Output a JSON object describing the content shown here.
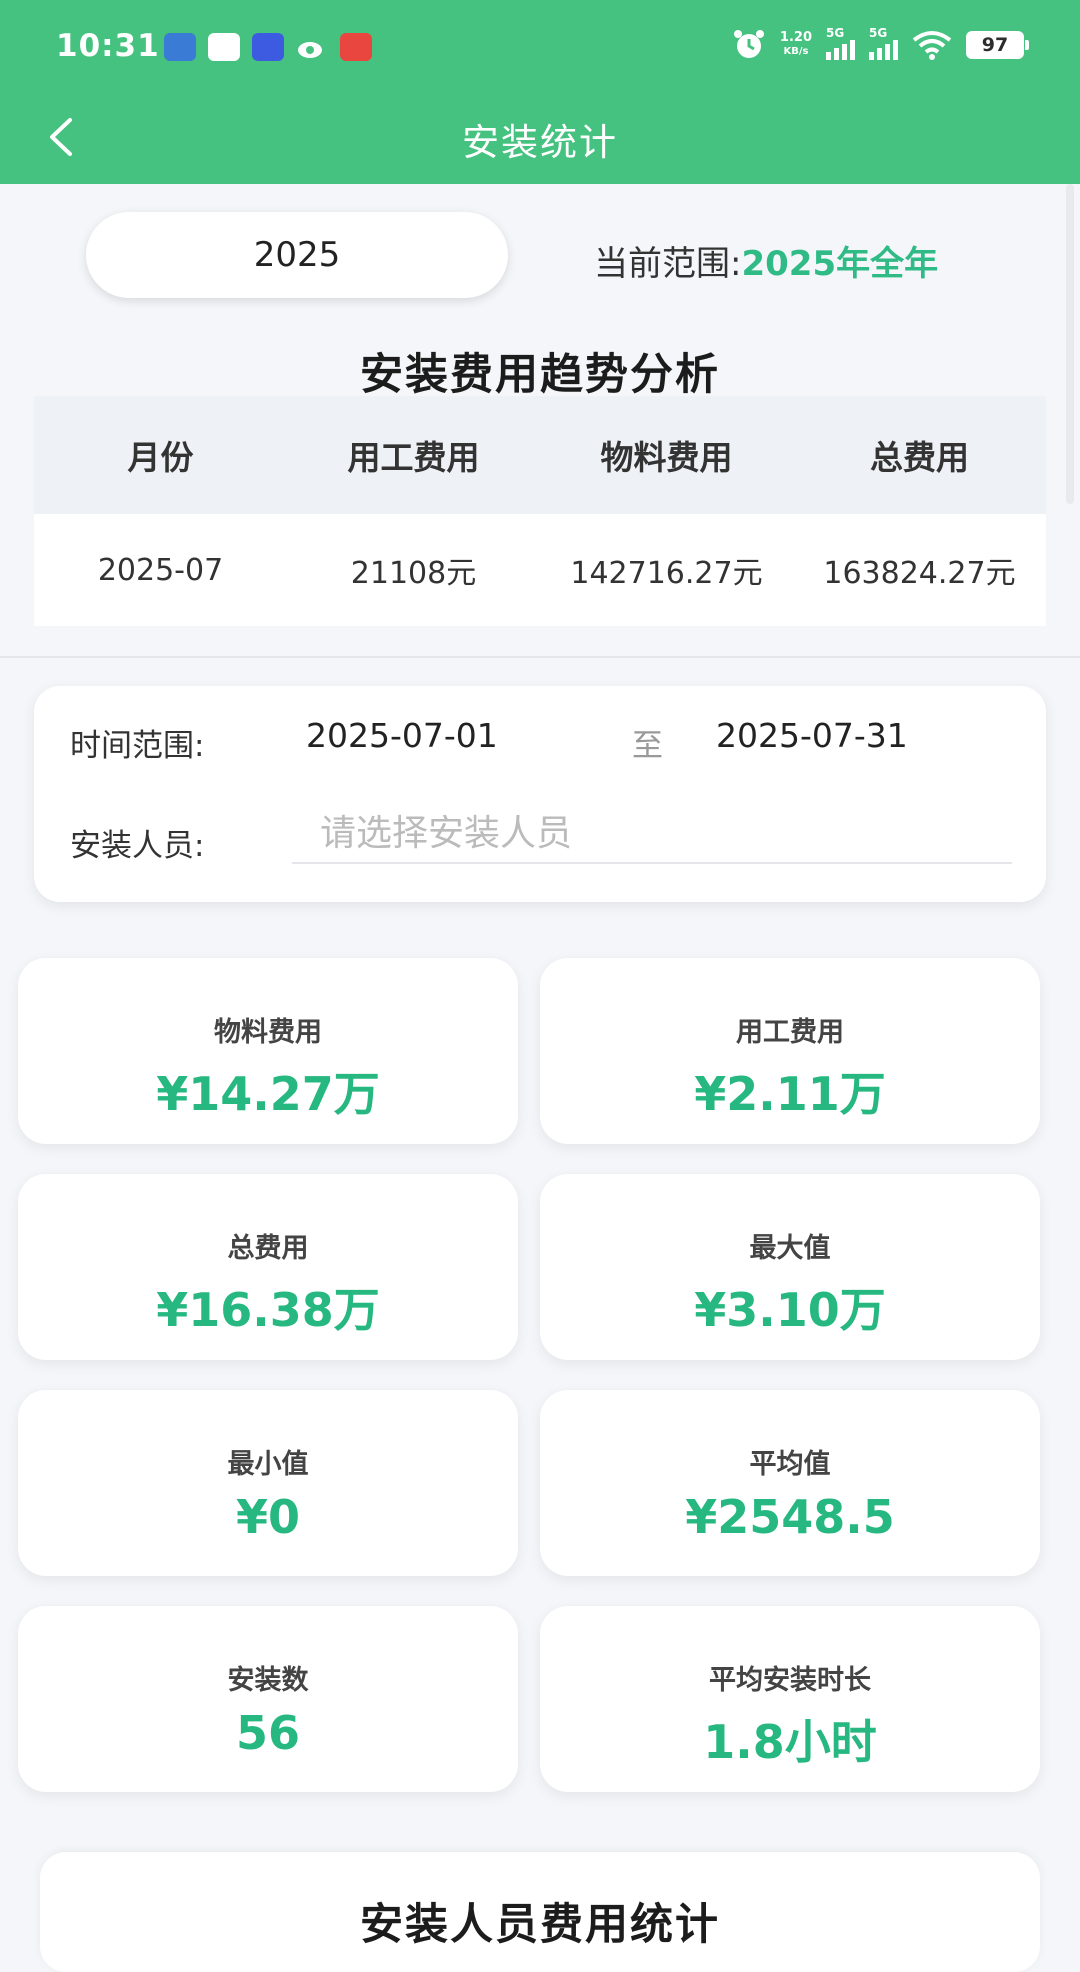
{
  "status_bar": {
    "time": "10:31",
    "net_speed_value": "1.20",
    "net_speed_unit": "KB/s",
    "signal_1_label": "5G",
    "signal_2_label": "5G",
    "battery": "97"
  },
  "nav": {
    "title": "安装统计"
  },
  "filter_year": {
    "value": "2025",
    "range_prefix": "当前范围:",
    "range_value": "2025年全年"
  },
  "trend": {
    "title": "安装费用趋势分析",
    "headers": [
      "月份",
      "用工费用",
      "物料费用",
      "总费用"
    ],
    "rows": [
      [
        "2025-07",
        "21108元",
        "142716.27元",
        "163824.27元"
      ]
    ]
  },
  "filters": {
    "time_label": "时间范围:",
    "start_date": "2025-07-01",
    "to_text": "至",
    "end_date": "2025-07-31",
    "installer_label": "安装人员:",
    "installer_placeholder": "请选择安装人员"
  },
  "stats": [
    {
      "label": "物料费用",
      "value": "¥14.27万"
    },
    {
      "label": "用工费用",
      "value": "¥2.11万"
    },
    {
      "label": "总费用",
      "value": "¥16.38万"
    },
    {
      "label": "最大值",
      "value": "¥3.10万"
    },
    {
      "label": "最小值",
      "value": "¥0"
    },
    {
      "label": "平均值",
      "value": "¥2548.5"
    },
    {
      "label": "安装数",
      "value": "56"
    },
    {
      "label": "平均安装时长",
      "value": "1.8小时"
    }
  ],
  "bottom_section": {
    "title": "安装人员费用统计"
  },
  "colors": {
    "brand_green": "#45c27f",
    "value_green": "#26b880"
  }
}
